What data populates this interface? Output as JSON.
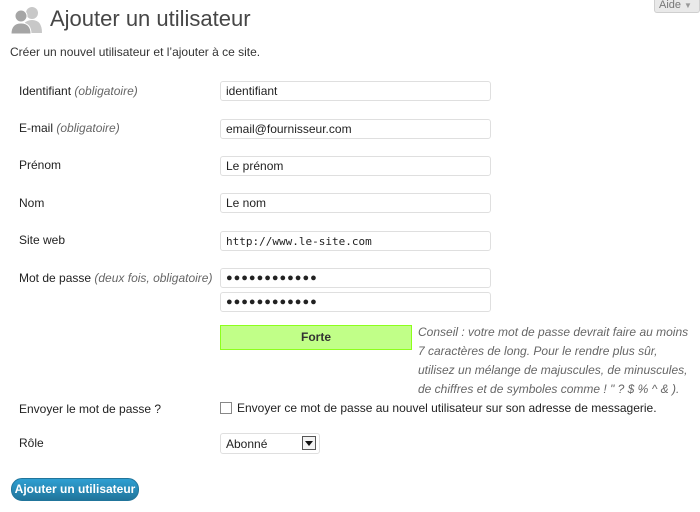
{
  "header": {
    "title": "Ajouter un utilisateur",
    "help_label": "Aide",
    "subtitle": "Créer un nouvel utilisateur et l’ajouter à ce site."
  },
  "form": {
    "username": {
      "label": "Identifiant",
      "note": "(obligatoire)",
      "value": "identifiant"
    },
    "email": {
      "label": "E-mail",
      "note": "(obligatoire)",
      "value": "email@fournisseur.com"
    },
    "first_name": {
      "label": "Prénom",
      "value": "Le prénom"
    },
    "last_name": {
      "label": "Nom",
      "value": "Le nom"
    },
    "website": {
      "label": "Site web",
      "value": "http://www.le-site.com"
    },
    "password": {
      "label": "Mot de passe",
      "note": "(deux fois, obligatoire)",
      "value1": "●●●●●●●●●●●●",
      "value2": "●●●●●●●●●●●●",
      "strength": "Forte",
      "hint": "Conseil : votre mot de passe devrait faire au moins 7 caractères de long. Pour le rendre plus sûr, utilisez un mélange de majuscules, de minuscules, de chiffres et de symboles comme ! \" ? $ % ^ & )."
    },
    "send_password": {
      "label": "Envoyer le mot de passe ?",
      "checkbox_label": "Envoyer ce mot de passe au nouvel utilisateur sur son adresse de messagerie.",
      "checked": false
    },
    "role": {
      "label": "Rôle",
      "selected": "Abonné"
    },
    "submit_label": "Ajouter un utilisateur"
  },
  "colors": {
    "strength_bg": "#c1ff88",
    "strength_border": "#8dff1c",
    "button_primary": "#21759b"
  },
  "icons": {
    "page_icon": "users-icon",
    "select_arrow": "chevron-down-icon"
  }
}
